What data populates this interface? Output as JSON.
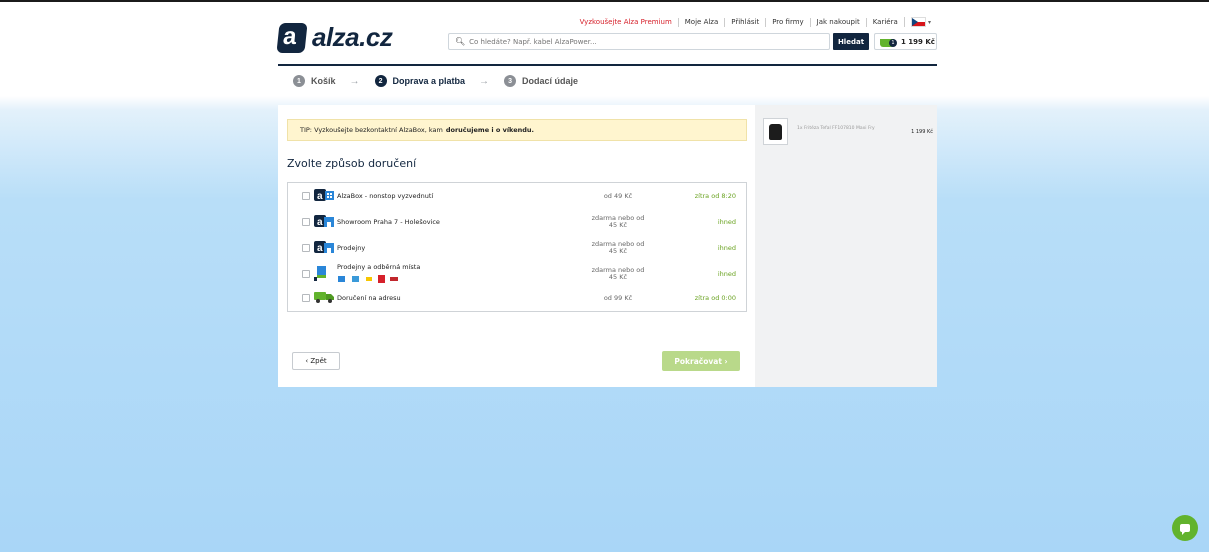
{
  "header": {
    "logo_text": "alza.cz",
    "logo_mark": "a",
    "nav": [
      "Vyzkoušejte Alza Premium",
      "Moje Alza",
      "Přihlásit",
      "Pro firmy",
      "Jak nakoupit",
      "Kariéra"
    ],
    "search_placeholder": "Co hledáte? Např. kabel AlzaPower...",
    "search_button": "Hledat",
    "cart_count": "1",
    "cart_total": "1 199 Kč"
  },
  "steps": [
    {
      "num": "1",
      "label": "Košík"
    },
    {
      "num": "2",
      "label": "Doprava a platba"
    },
    {
      "num": "3",
      "label": "Dodací údaje"
    }
  ],
  "tip": {
    "prefix": "TIP: Vyzkoušejte bezkontaktní AlzaBox, kam",
    "bold": "doručujeme i o víkendu."
  },
  "heading": "Zvolte způsob doručení",
  "options": [
    {
      "label": "AlzaBox - nonstop vyzvednutí",
      "price": "od 49 Kč",
      "price2": "",
      "when": "zítra od 8:20",
      "icon": "alzabox-icon"
    },
    {
      "label": "Showroom Praha 7 - Holešovice",
      "price": "zdarma nebo od",
      "price2": "45 Kč",
      "when": "ihned",
      "icon": "showroom-icon"
    },
    {
      "label": "Prodejny",
      "price": "zdarma nebo od",
      "price2": "45 Kč",
      "when": "ihned",
      "icon": "store-icon"
    },
    {
      "label": "Prodejny a odběrná místa",
      "price": "zdarma nebo od",
      "price2": "45 Kč",
      "when": "ihned",
      "icon": "pickup-points-icon"
    },
    {
      "label": "Doručení na adresu",
      "price": "od 99 Kč",
      "price2": "",
      "when": "zítra od 0:00",
      "icon": "delivery-truck-icon"
    }
  ],
  "buttons": {
    "back": "‹ Zpět",
    "next": "Pokračovat ›"
  },
  "summary": {
    "product": "1x Fritéza Tefal FF107810 Maxi Fry",
    "price": "1 199 Kč"
  },
  "colors": {
    "brand": "#12263f",
    "accent_green": "#62b32d",
    "when_green": "#6aa321",
    "tip_bg": "#fff5cf"
  }
}
